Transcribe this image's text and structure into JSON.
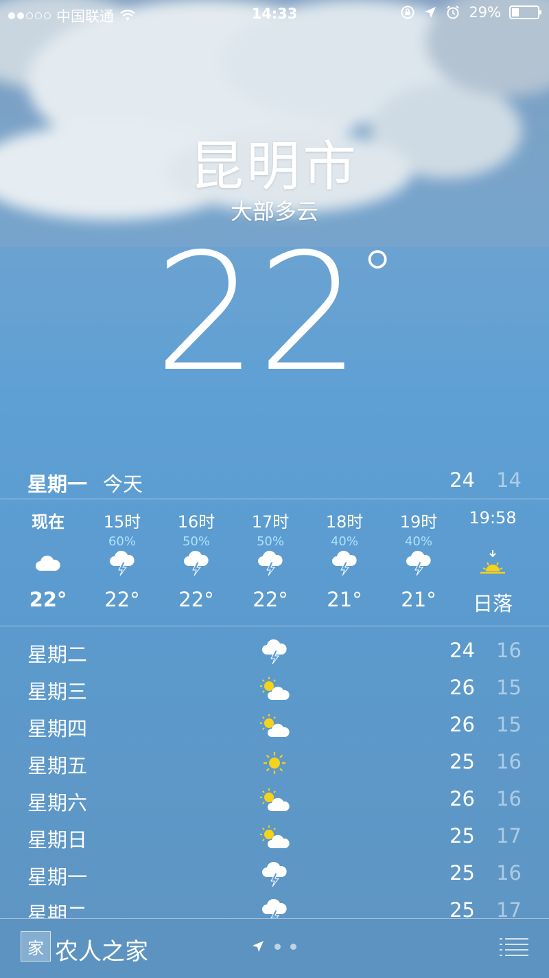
{
  "status_bar": {
    "carrier": "中国联通",
    "time": "14:33",
    "battery": "29%"
  },
  "location": {
    "city": "昆明市",
    "condition": "大部多云",
    "temperature": "22",
    "degree_symbol": "°"
  },
  "today": {
    "day": "星期一",
    "label": "今天",
    "high": "24",
    "low": "14"
  },
  "hourly": [
    {
      "time": "现在",
      "precip": "",
      "icon": "cloud-icon",
      "temp": "22°"
    },
    {
      "time": "15时",
      "precip": "60%",
      "icon": "thunderstorm-icon",
      "temp": "22°"
    },
    {
      "time": "16时",
      "precip": "50%",
      "icon": "thunderstorm-icon",
      "temp": "22°"
    },
    {
      "time": "17时",
      "precip": "50%",
      "icon": "thunderstorm-icon",
      "temp": "22°"
    },
    {
      "time": "18时",
      "precip": "40%",
      "icon": "thunderstorm-icon",
      "temp": "21°"
    },
    {
      "time": "19时",
      "precip": "40%",
      "icon": "thunderstorm-icon",
      "temp": "21°"
    },
    {
      "time": "19:58",
      "precip": "",
      "icon": "sunset-icon",
      "temp": "日落"
    }
  ],
  "daily": [
    {
      "day": "星期二",
      "icon": "thunderstorm-icon",
      "high": "24",
      "low": "16"
    },
    {
      "day": "星期三",
      "icon": "partly-sunny-icon",
      "high": "26",
      "low": "15"
    },
    {
      "day": "星期四",
      "icon": "partly-sunny-icon",
      "high": "26",
      "low": "15"
    },
    {
      "day": "星期五",
      "icon": "sun-icon",
      "high": "25",
      "low": "16"
    },
    {
      "day": "星期六",
      "icon": "partly-sunny-icon",
      "high": "26",
      "low": "16"
    },
    {
      "day": "星期日",
      "icon": "partly-sunny-icon",
      "high": "25",
      "low": "17"
    },
    {
      "day": "星期一",
      "icon": "thunderstorm-icon",
      "high": "25",
      "low": "16"
    },
    {
      "day": "星期二",
      "icon": "thunderstorm-icon",
      "high": "25",
      "low": "17"
    }
  ],
  "bottom_bar": {
    "watermark": "农人之家",
    "logo_glyph": "家"
  },
  "colors": {
    "sky": "#5fa0d4",
    "precip": "#aee3ff",
    "sun": "#f7d21a"
  }
}
